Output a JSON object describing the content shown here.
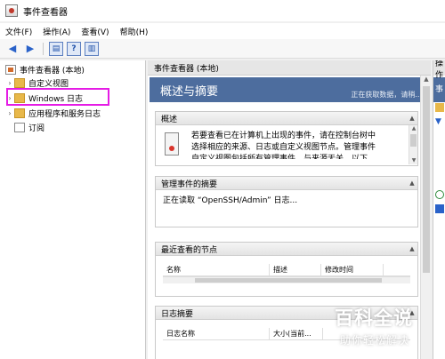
{
  "window": {
    "title": "事件查看器"
  },
  "menu": {
    "items": [
      "文件(F)",
      "操作(A)",
      "查看(V)",
      "帮助(H)"
    ]
  },
  "tree": {
    "root": "事件查看器 (本地)",
    "items": [
      {
        "label": "自定义视图"
      },
      {
        "label": "Windows 日志"
      },
      {
        "label": "应用程序和服务日志"
      },
      {
        "label": "订阅"
      }
    ]
  },
  "center": {
    "header": "事件查看器 (本地)",
    "banner_title": "概述与摘要",
    "banner_status": "正在获取数据，请稍...",
    "overview": {
      "title": "概述",
      "lines": [
        "若要查看已在计算机上出现的事件，请在控制台树中",
        "选择相应的来源、日志或自定义视图节点。管理事件",
        "自定义视图包括所有管理事件，与来源无关。以下"
      ]
    },
    "admin_summary": {
      "title": "管理事件的摘要",
      "status": "正在读取 “OpenSSH/Admin” 日志..."
    },
    "recent_nodes": {
      "title": "最近查看的节点",
      "columns": [
        "名称",
        "描述",
        "修改时间"
      ]
    },
    "log_summary": {
      "title": "日志摘要",
      "columns": [
        "日志名称",
        "大小(当前..."
      ]
    }
  },
  "right": {
    "header": "操作",
    "bar": "事"
  },
  "watermark": {
    "big": "百科全说",
    "small": "助你轻松解决"
  },
  "colors": {
    "banner": "#4d6d9e",
    "highlight_box": "#e51ce5",
    "folder": "#e8b84a"
  }
}
